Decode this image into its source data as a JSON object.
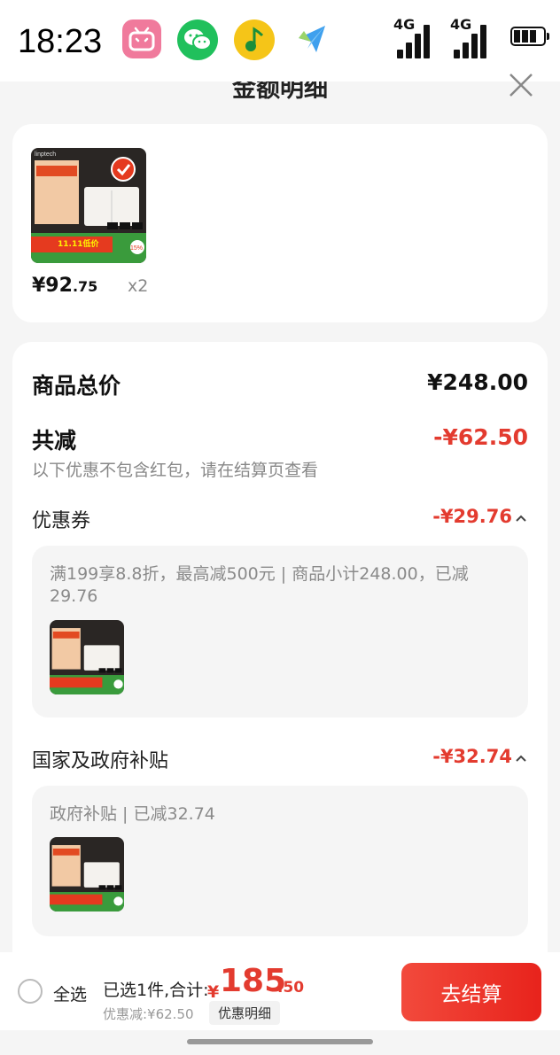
{
  "status_bar": {
    "time": "18:23",
    "apps": [
      "bilibili-icon",
      "wechat-icon",
      "qq-music-icon",
      "paper-plane-icon"
    ],
    "network1": "4G",
    "network2": "4G",
    "battery_level": 0.6
  },
  "sheet": {
    "title": "金额明细",
    "close_icon": "close-icon"
  },
  "product": {
    "price_int": "¥92",
    "price_dec": ".75",
    "quantity": "x2",
    "brand": "linptech",
    "promo_big": "11.11低价",
    "promo_pct": "15%"
  },
  "breakdown": {
    "total_label": "商品总价",
    "total_value": "¥248.00",
    "reduce_label": "共减",
    "reduce_value": "-¥62.50",
    "note": "以下优惠不包含红包，请在结算页查看",
    "coupon": {
      "label": "优惠券",
      "value": "-¥29.76",
      "detail": "满199享8.8折，最高减500元 | 商品小计248.00，已减29.76"
    },
    "subsidy": {
      "label": "国家及政府补贴",
      "value": "-¥32.74",
      "detail": "政府补贴 | 已减32.74"
    }
  },
  "bottom": {
    "select_all": "全选",
    "summary": "已选1件,合计:",
    "currency": "¥",
    "total_int": "185",
    "total_dec": ".50",
    "discount": "优惠减:¥62.50",
    "detail_link": "优惠明细",
    "checkout": "去结算"
  },
  "colors": {
    "accent_red": "#e33b2f",
    "button_red": "#e8231c"
  }
}
